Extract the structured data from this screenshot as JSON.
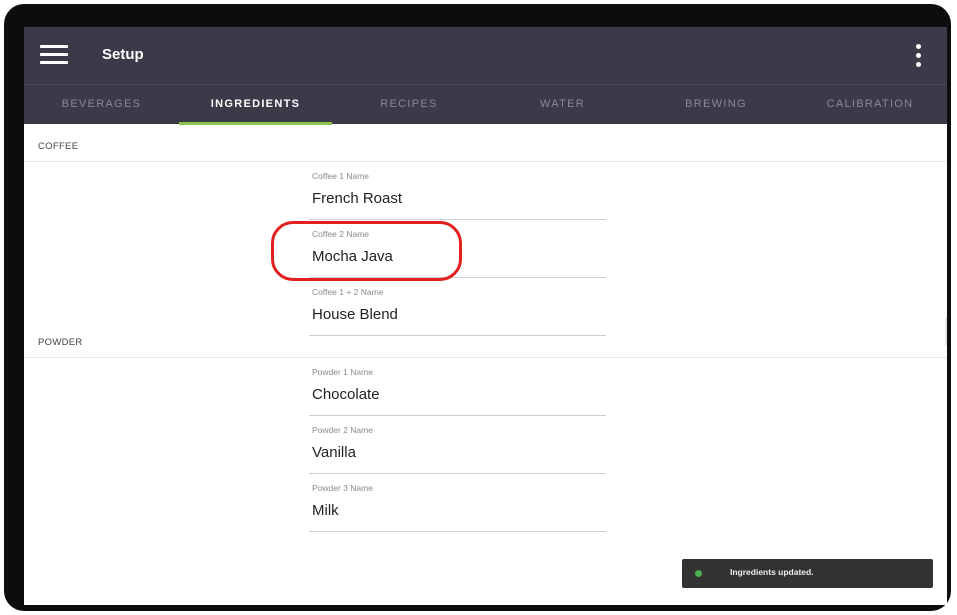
{
  "header": {
    "title": "Setup",
    "menu_icon": "hamburger-menu-icon",
    "overflow_icon": "more-vertical-icon"
  },
  "tabs": [
    {
      "label": "BEVERAGES",
      "active": false
    },
    {
      "label": "INGREDIENTS",
      "active": true
    },
    {
      "label": "RECIPES",
      "active": false
    },
    {
      "label": "WATER",
      "active": false
    },
    {
      "label": "BREWING",
      "active": false
    },
    {
      "label": "CALIBRATION",
      "active": false
    }
  ],
  "sections": {
    "coffee": {
      "label": "COFFEE",
      "fields": [
        {
          "label": "Coffee 1 Name",
          "value": "French Roast"
        },
        {
          "label": "Coffee 2 Name",
          "value": "Mocha Java"
        },
        {
          "label": "Coffee 1 + 2 Name",
          "value": "House Blend"
        }
      ]
    },
    "powder": {
      "label": "POWDER",
      "fields": [
        {
          "label": "Powder 1 Name",
          "value": "Chocolate"
        },
        {
          "label": "Powder 2 Name",
          "value": "Vanilla"
        },
        {
          "label": "Powder 3 Name",
          "value": "Milk"
        }
      ]
    }
  },
  "toast": {
    "message": "Ingredients updated.",
    "status_color": "#4caf50"
  },
  "colors": {
    "app_bar": "#3c3a48",
    "tab_indicator": "#8bc34a",
    "annotation": "#e32020"
  }
}
